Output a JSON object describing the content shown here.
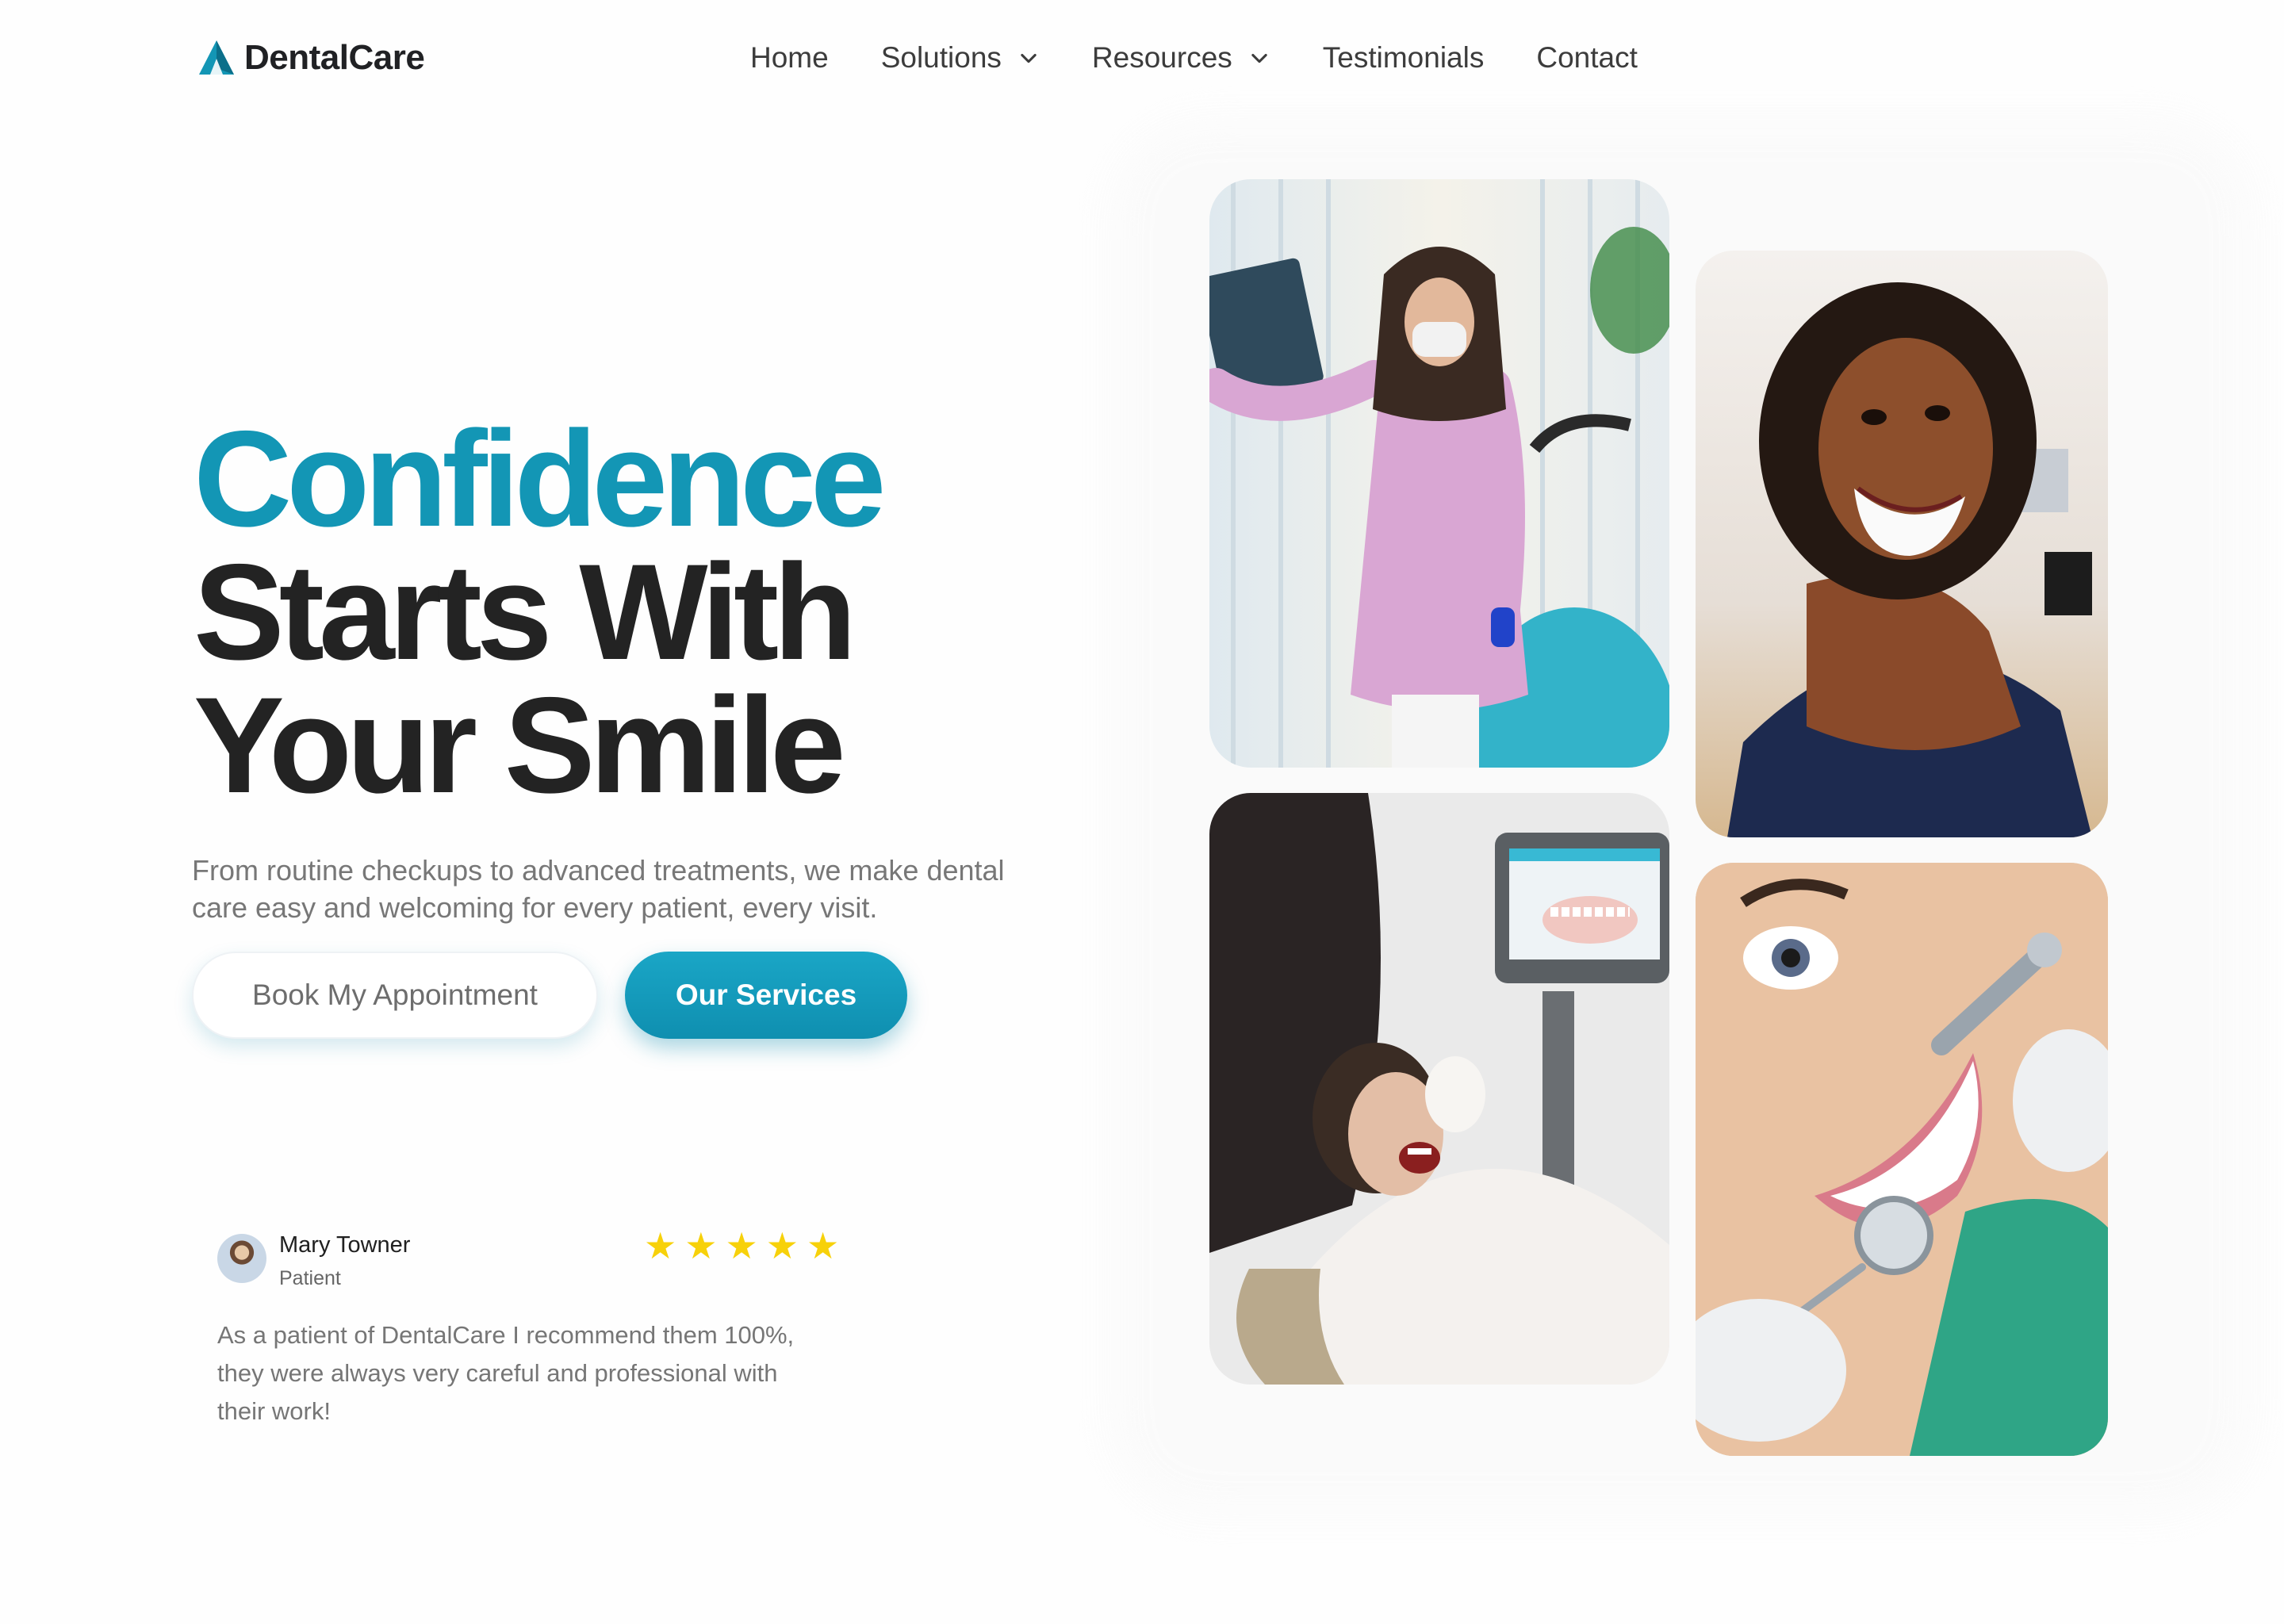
{
  "brand": {
    "name": "DentalCare",
    "accent_color": "#1396b5"
  },
  "nav": {
    "items": [
      {
        "label": "Home",
        "has_dropdown": false
      },
      {
        "label": "Solutions",
        "has_dropdown": true
      },
      {
        "label": "Resources",
        "has_dropdown": true
      },
      {
        "label": "Testimonials",
        "has_dropdown": false
      },
      {
        "label": "Contact",
        "has_dropdown": false
      }
    ]
  },
  "hero": {
    "headline_accent": "Confidence",
    "headline_line2": "Starts With",
    "headline_line3": "Your Smile",
    "subtitle": "From routine checkups to advanced treatments, we make dental care easy and welcoming for every patient, every visit.",
    "primary_button": "Book My Appointment",
    "secondary_button": "Our Services",
    "button_color": "#1396b5"
  },
  "testimonial": {
    "name": "Mary Towner",
    "role": "Patient",
    "rating": 5,
    "star_color": "#f7d10a",
    "quote": "As a patient of DentalCare I recommend them 100%, they were always very careful and professional with their work!"
  },
  "photos": [
    {
      "icon": "dentist-xray-photo"
    },
    {
      "icon": "smiling-woman-photo"
    },
    {
      "icon": "patient-exam-photo"
    },
    {
      "icon": "dental-cleaning-photo"
    }
  ]
}
